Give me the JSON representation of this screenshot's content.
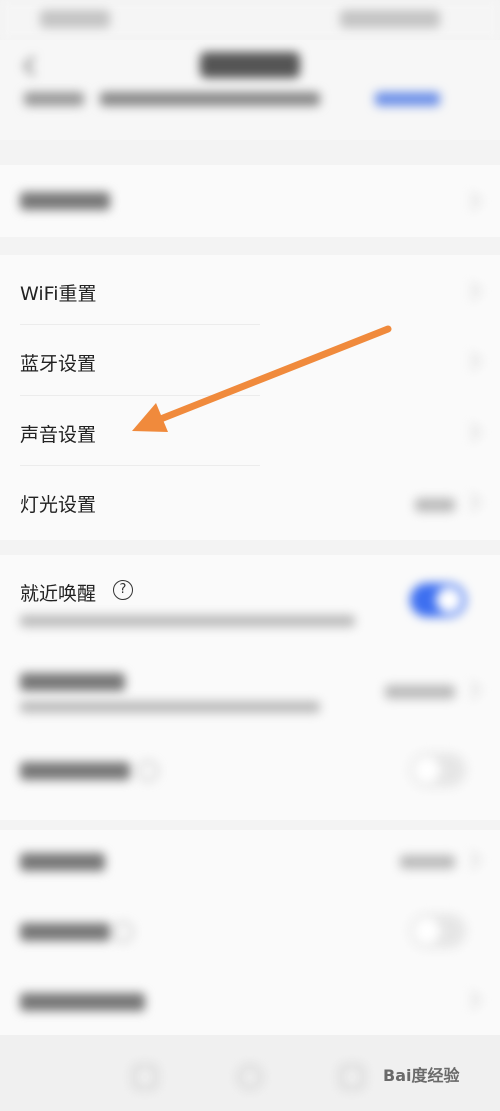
{
  "status_bar": {
    "left_text": "",
    "right_text": ""
  },
  "header": {
    "title": "",
    "device_name": "",
    "action_link": ""
  },
  "section_1": {
    "item_1": {
      "label": ""
    }
  },
  "section_2": {
    "wifi_reset": {
      "label": "WiFi重置"
    },
    "bluetooth_settings": {
      "label": "蓝牙设置"
    },
    "sound_settings": {
      "label": "声音设置"
    },
    "light_settings": {
      "label": "灯光设置",
      "value": ""
    }
  },
  "section_3": {
    "nearby_wake": {
      "label": "就近唤醒",
      "help_glyph": "?",
      "description": "当附近有多台小度设备时，离你最近的",
      "toggle_on": true
    },
    "assist_wake_word": {
      "label": "辅助唤醒词",
      "value": "",
      "description": ""
    },
    "item_3": {
      "label": "",
      "toggle_on": false
    }
  },
  "section_4": {
    "item_1": {
      "label": "",
      "value": ""
    },
    "item_2": {
      "label": "",
      "toggle_on": false
    },
    "item_3": {
      "label": ""
    }
  },
  "watermark": {
    "text": "Bai度经验"
  },
  "colors": {
    "accent": "#3d6ff0",
    "arrow": "#f08a3c",
    "background": "#f3f3f3"
  }
}
